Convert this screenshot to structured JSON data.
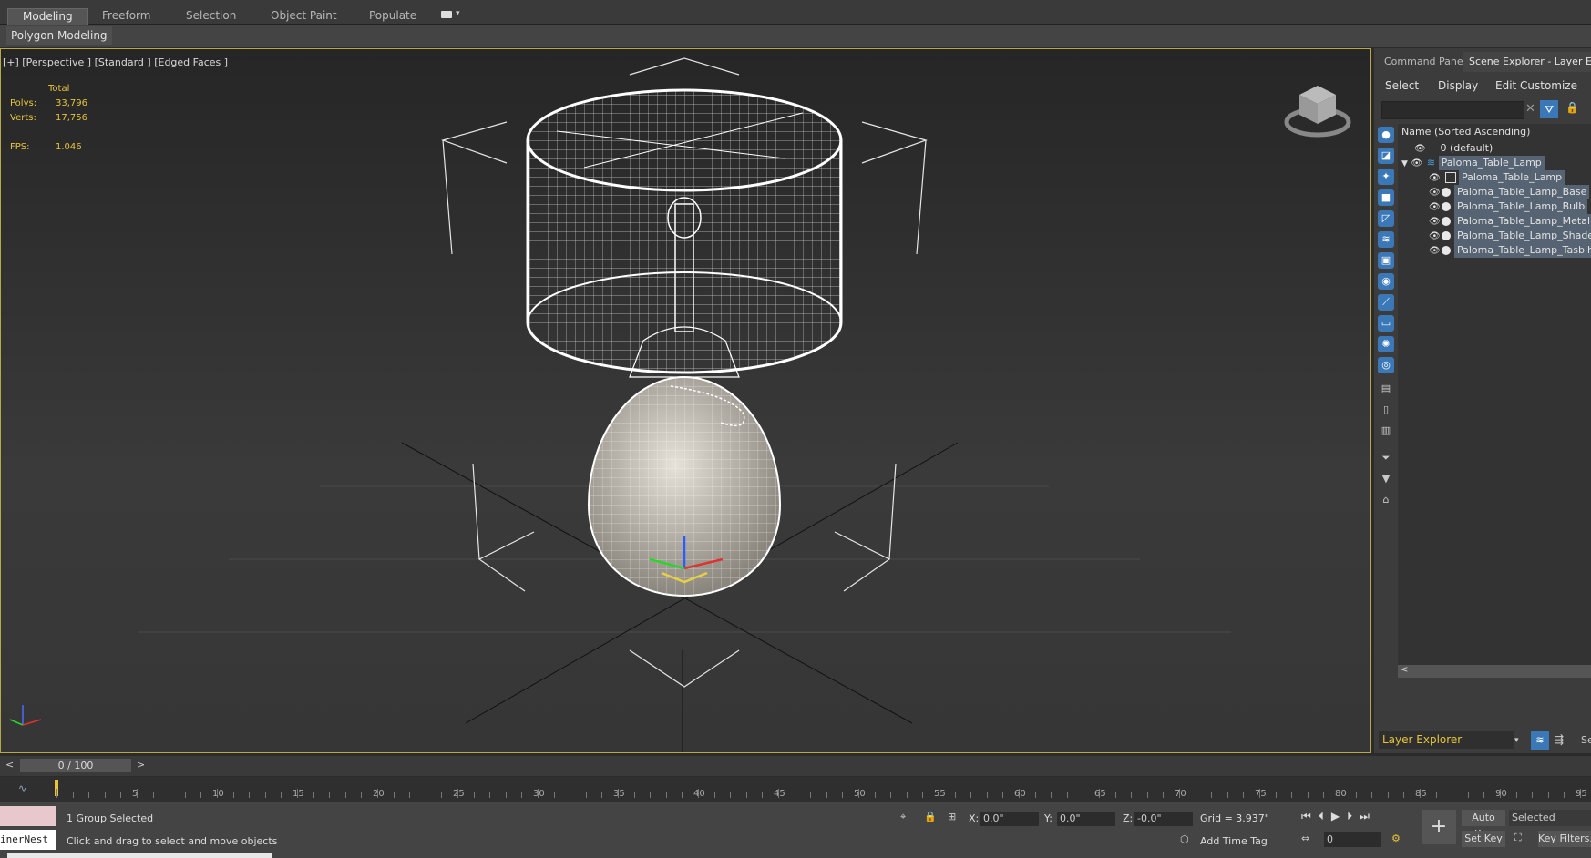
{
  "ribbon": {
    "tabs": [
      "Modeling",
      "Freeform",
      "Selection",
      "Object Paint",
      "Populate"
    ],
    "panel_title": "Polygon Modeling"
  },
  "viewport": {
    "label": "[+] [Perspective ] [Standard ] [Edged Faces ]",
    "stats_header": "Total",
    "polys_label": "Polys:",
    "polys_value": "33,796",
    "verts_label": "Verts:",
    "verts_value": "17,756",
    "fps_label": "FPS:",
    "fps_value": "1.046"
  },
  "panel": {
    "tabs": [
      "Command Panel",
      "Scene Explorer - Layer Exp"
    ],
    "menu": [
      "Select",
      "Display",
      "Edit",
      "Customize"
    ],
    "tree_header": "Name (Sorted Ascending)",
    "items": [
      {
        "name": "0 (default)"
      },
      {
        "name": "Paloma_Table_Lamp"
      },
      {
        "name": "Paloma_Table_Lamp"
      },
      {
        "name": "Paloma_Table_Lamp_Base"
      },
      {
        "name": "Paloma_Table_Lamp_Bulb"
      },
      {
        "name": "Paloma_Table_Lamp_Metal"
      },
      {
        "name": "Paloma_Table_Lamp_Shade"
      },
      {
        "name": "Paloma_Table_Lamp_Tasbih"
      }
    ],
    "explorer_name": "Layer Explorer",
    "side_cut": "Se"
  },
  "timeline": {
    "slider_value": "0 / 100",
    "prev": "<",
    "next": ">",
    "ticks": [
      "5",
      "10",
      "15",
      "20",
      "25",
      "30",
      "35",
      "40",
      "45",
      "50",
      "55",
      "60",
      "65",
      "70",
      "75",
      "80",
      "85",
      "90",
      "95"
    ]
  },
  "status": {
    "script_text": "inerNest",
    "selection": "1 Group Selected",
    "prompt": "Click and drag to select and move objects",
    "x_label": "X:",
    "x_value": "0.0\"",
    "y_label": "Y:",
    "y_value": "0.0\"",
    "z_label": "Z:",
    "z_value": "-0.0\"",
    "grid": "Grid = 3.937\"",
    "add_time_tag": "Add Time Tag",
    "auto_key": "Auto Key",
    "selected": "Selected",
    "set_key": "Set Key",
    "key_filters": "Key Filters...",
    "frame": "0"
  }
}
